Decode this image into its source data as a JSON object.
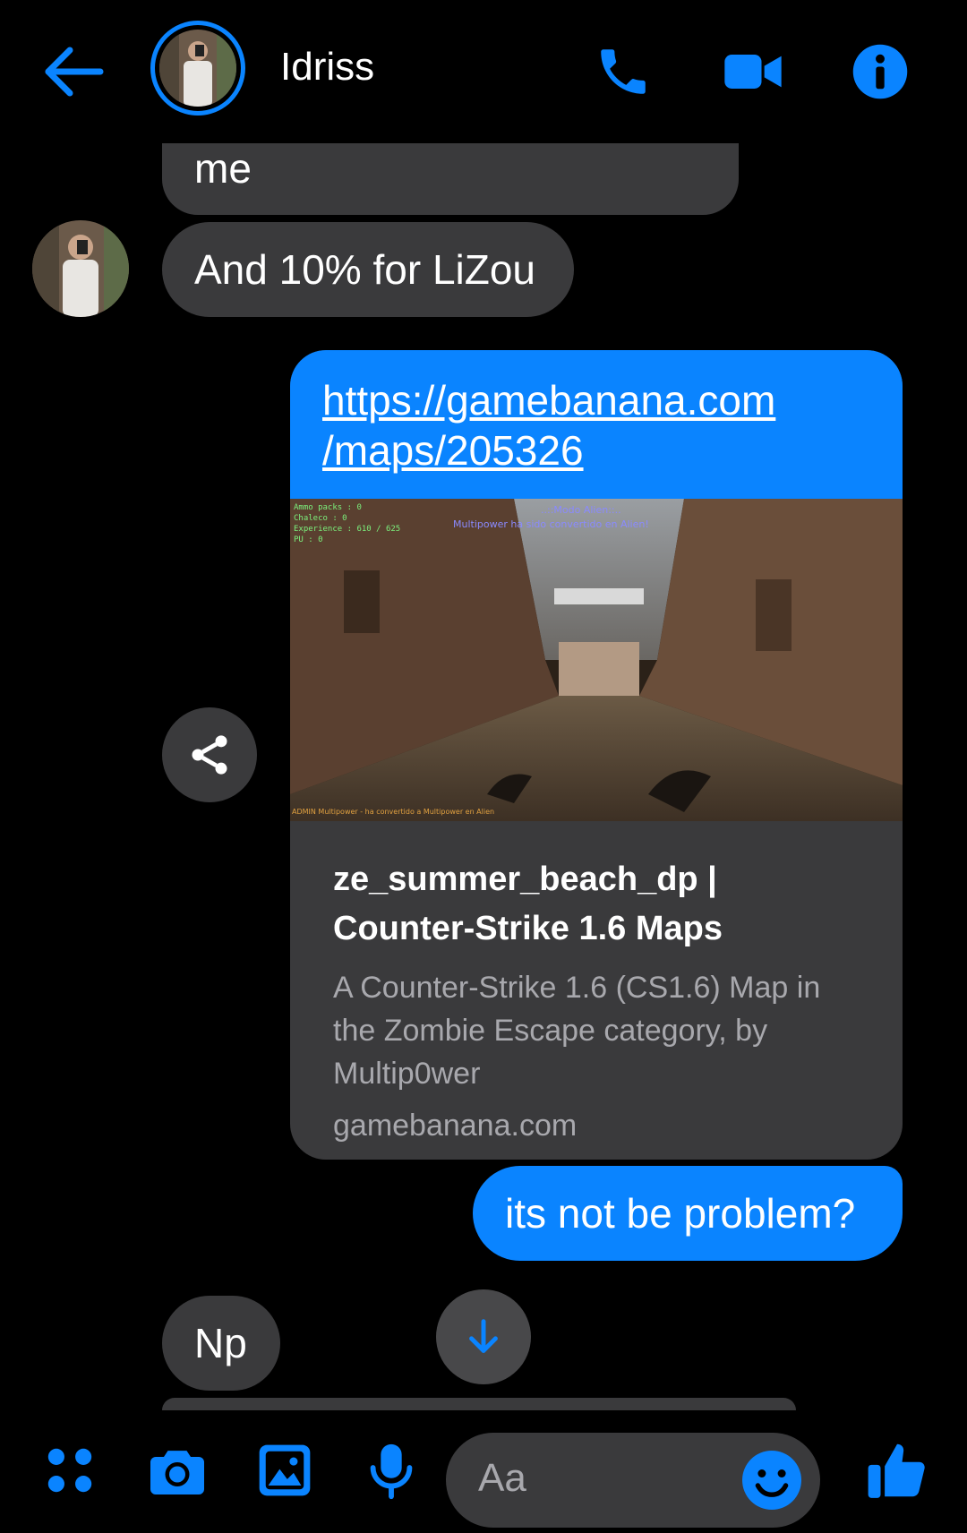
{
  "header": {
    "contact_name": "Idriss",
    "icons": [
      "back-arrow-icon",
      "phone-icon",
      "video-camera-icon",
      "info-icon"
    ]
  },
  "messages": {
    "partial_incoming": "me",
    "incoming_1": "And 10% for LiZou",
    "link": {
      "url_line1": "https://gamebanana.com",
      "url_line2": "/maps/205326",
      "preview_hud": {
        "line1": "Ammo packs : 0",
        "line2": "Chaleco : 0",
        "line3": "Experience : 610 / 625",
        "line4": "PU : 0",
        "center1": "..::Modo Alien::..",
        "center2": "Multipower ha sido convertido en Alien!",
        "bottom": "ADMIN Multipower - ha convertido a Multipower en Alien"
      },
      "title_line1": "ze_summer_beach_dp |",
      "title_line2": "Counter-Strike 1.6 Maps",
      "description": "A Counter-Strike 1.6 (CS1.6) Map in the Zombie Escape category, by Multip0wer",
      "domain": "gamebanana.com"
    },
    "outgoing_2": "its not be problem?",
    "incoming_2": "Np"
  },
  "composer": {
    "placeholder": "Aa",
    "icons": [
      "apps-grid-icon",
      "camera-icon",
      "gallery-icon",
      "microphone-icon",
      "emoji-icon",
      "thumbs-up-icon"
    ]
  },
  "colors": {
    "accent": "#0a84ff",
    "incoming_bubble": "#3a3a3c",
    "background": "#000000"
  }
}
